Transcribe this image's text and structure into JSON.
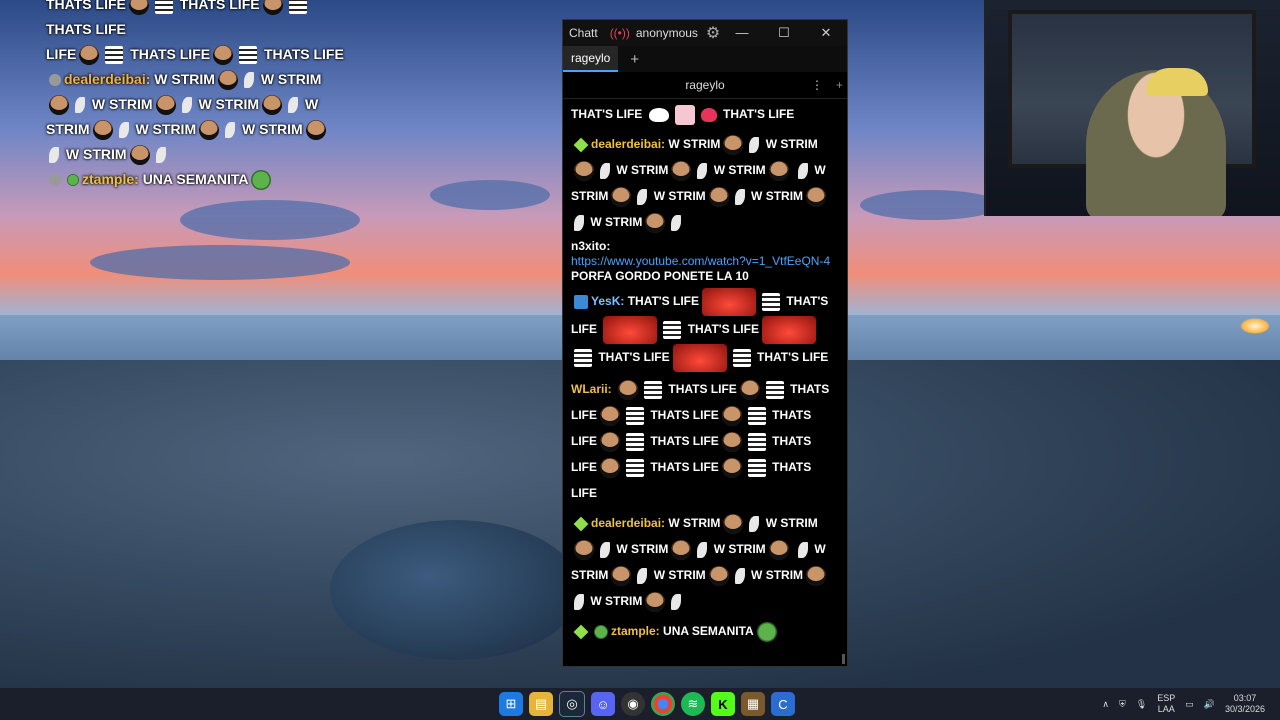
{
  "overlay_chat": {
    "line1": "THATS LIFE",
    "line1b": "THATS LIFE",
    "line1c": "THATS LIFE",
    "line2a": "LIFE",
    "line2b": "THATS LIFE",
    "line2c": "THATS LIFE",
    "msg1_user": "dealerdeibai:",
    "msg1_text": "W STRIM",
    "w_strim": "W STRIM",
    "strim_word": "STRIM",
    "msg2_user": "ztample:",
    "msg2_text": "UNA SEMANITA"
  },
  "chat_window": {
    "app_title": "Chatt",
    "user": "anonymous",
    "minimize": "—",
    "maximize": "☐",
    "close": "✕",
    "tab_label": "rageylo",
    "tab_add": "+",
    "channel_name": "rageylo",
    "menu_icon": "⋮",
    "split_add": "+"
  },
  "messages": {
    "m0_text": "THAT'S LIFE",
    "m0_text2": "THAT'S LIFE",
    "m1_user": "dealerdeibai:",
    "w": "W STRIM",
    "m2_user": "n3xito:",
    "m2_link": "https://www.youtube.com/watch?v=1_VtfEeQN-4",
    "m2_text": "PORFA GORDO PONETE LA 10",
    "m3_user": "YesK:",
    "thats_life": "THAT'S LIFE",
    "m4_user": "WLarii:",
    "thats_life_caps": "THATS LIFE",
    "thats": "THATS",
    "life": "LIFE",
    "m5_user": "dealerdeibai:",
    "m6_user": "ztample:",
    "m6_text": "UNA SEMANITA"
  },
  "taskbar": {
    "icons": [
      "windows-start",
      "file-explorer",
      "steam",
      "discord",
      "obs",
      "chrome",
      "spotify",
      "kick",
      "minecraft",
      "chatterino"
    ],
    "lang_top": "ESP",
    "lang_bottom": "LAA",
    "time": "03:07",
    "date": "30/3/2026"
  }
}
